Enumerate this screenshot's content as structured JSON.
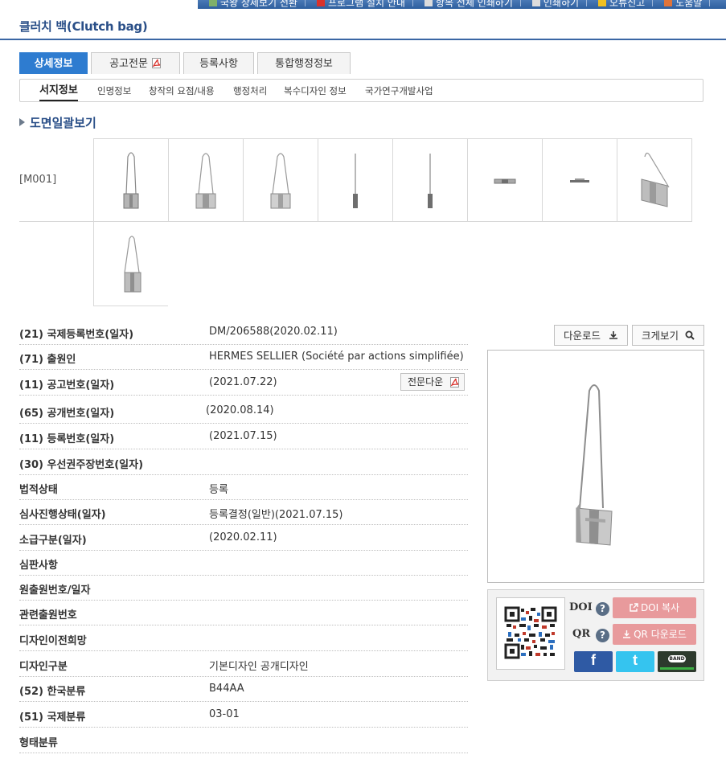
{
  "topbar": {
    "items": [
      {
        "label": "국왕 상세보기 전환",
        "icon": "map-icon"
      },
      {
        "label": "프로그램 설치 안내",
        "icon": "pdf-icon"
      },
      {
        "label": "항목 전체 인쇄하기",
        "icon": "print-icon"
      },
      {
        "label": "인쇄하기",
        "icon": "print-icon"
      },
      {
        "label": "오류신고",
        "icon": "warning-icon"
      },
      {
        "label": "도움말",
        "icon": "help-icon"
      }
    ]
  },
  "title": "클러치 백(Clutch bag)",
  "tabs": [
    {
      "label": "상세정보",
      "active": true
    },
    {
      "label": "공고전문",
      "icon": "pdf-icon"
    },
    {
      "label": "등록사항"
    },
    {
      "label": "통합행정정보"
    }
  ],
  "subnav": [
    "서지정보",
    "인명정보",
    "창작의 요점/내용",
    "행정처리",
    "복수디자인 정보",
    "국가연구개발사업"
  ],
  "section_heading": "도면일괄보기",
  "drawings": {
    "label": "[M001]",
    "count": 9
  },
  "biblio": [
    {
      "label": "(21) 국제등록번호(일자)",
      "value": "DM/206588(2020.02.11)"
    },
    {
      "label": "(71) 출원인",
      "value": "HERMES SELLIER (Société par actions simplifiée)"
    },
    {
      "label": "(11) 공고번호(일자)",
      "value": "(2021.07.22)"
    },
    {
      "label": "(65) 공개번호(일자)",
      "value": "(2020.08.14)"
    },
    {
      "label": "(11) 등록번호(일자)",
      "value": "(2021.07.15)"
    },
    {
      "label": "(30) 우선권주장번호(일자)",
      "value": ""
    },
    {
      "label": "법적상태",
      "value": "등록"
    },
    {
      "label": "심사진행상태(일자)",
      "value": "등록결정(일반)(2021.07.15)"
    },
    {
      "label": "소급구분(일자)",
      "value": "(2020.02.11)"
    },
    {
      "label": "심판사항",
      "value": ""
    },
    {
      "label": "원출원번호/일자",
      "value": ""
    },
    {
      "label": "관련출원번호",
      "value": ""
    },
    {
      "label": "디자인이전희망",
      "value": ""
    },
    {
      "label": "디자인구분",
      "value": "기본디자인 공개디자인"
    },
    {
      "label": "(52) 한국분류",
      "value": "B44AA"
    },
    {
      "label": "(51) 국제분류",
      "value": "03-01"
    },
    {
      "label": "형태분류",
      "value": ""
    }
  ],
  "fulltext_button": "전문다운",
  "right": {
    "download_label": "다운로드",
    "zoom_label": "크게보기",
    "doi_label": "DOI",
    "doi_button": "DOI 복사",
    "qr_label": "QR",
    "qr_button": "QR 다운로드",
    "social": [
      {
        "name": "facebook",
        "text": "f",
        "color": "#2f5aa4"
      },
      {
        "name": "twitter",
        "text": "t",
        "color": "#35c4ef"
      },
      {
        "name": "band",
        "text": "BAND",
        "color": "#2d3a2d"
      }
    ]
  },
  "colors": {
    "accent": "#2e7cd0",
    "title": "#2a4f88",
    "pink_button": "#e89a9c"
  }
}
